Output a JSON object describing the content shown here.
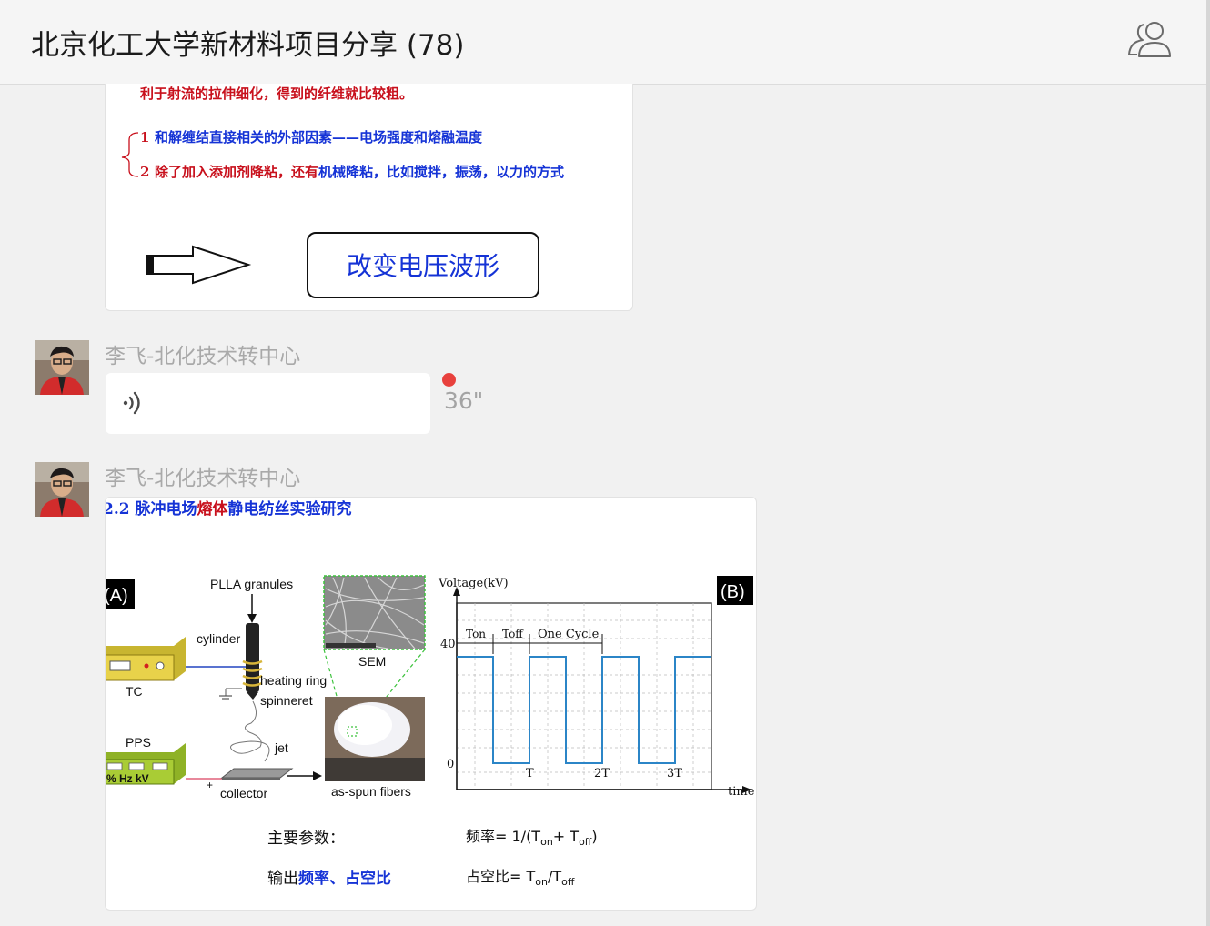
{
  "header": {
    "title": "北京化工大学新材料项目分享 (78)",
    "members_icon": "group-members-icon"
  },
  "slide1": {
    "line_top": "利于射流的拉伸细化，得到的纤维就比较粗。",
    "item1_num": "1",
    "item1_text": "和解缠结直接相关的外部因素——电场强度和熔融温度",
    "item2_num": "2",
    "item2_a": "除了加入添加剂降粘，还有",
    "item2_b": "机械降粘，比如搅拌，振荡，以力的方式",
    "box_text": "改变电压波形"
  },
  "messages": [
    {
      "sender": "李飞-北化技术转中心",
      "type": "voice",
      "duration": "36\""
    },
    {
      "sender": "李飞-北化技术转中心",
      "type": "image"
    }
  ],
  "slide2": {
    "title_a": "2.2 脉冲电场",
    "title_b": "熔体",
    "title_c": "静电纺丝实验研究",
    "panel_a": "(A)",
    "panel_b": "(B)",
    "pla": "PLLA granules",
    "cylinder": "cylinder",
    "heating": "heating ring",
    "spinneret": "spinneret",
    "tc": "TC",
    "pps": "PPS",
    "pps_units": "% Hz kV",
    "jet": "jet",
    "collector": "collector",
    "sem": "SEM",
    "fibers": "as-spun fibers",
    "plus": "+",
    "voltage": "Voltage(kV)",
    "time": "time",
    "v40": "40",
    "v0": "0",
    "ton": "Ton",
    "toff": "Toff",
    "cycle": "One Cycle",
    "t1": "T",
    "t2": "2T",
    "t3": "3T",
    "params_label": "主要参数：",
    "output_a": "输出",
    "output_b": "频率、占空比",
    "freq": "频率= 1/(T",
    "freq_on": "on",
    "freq_plus": "+ T",
    "freq_off": "off",
    "freq_end": ")",
    "duty": "占空比= T",
    "duty_on": "on",
    "duty_slash": "/T",
    "duty_off": "off"
  }
}
